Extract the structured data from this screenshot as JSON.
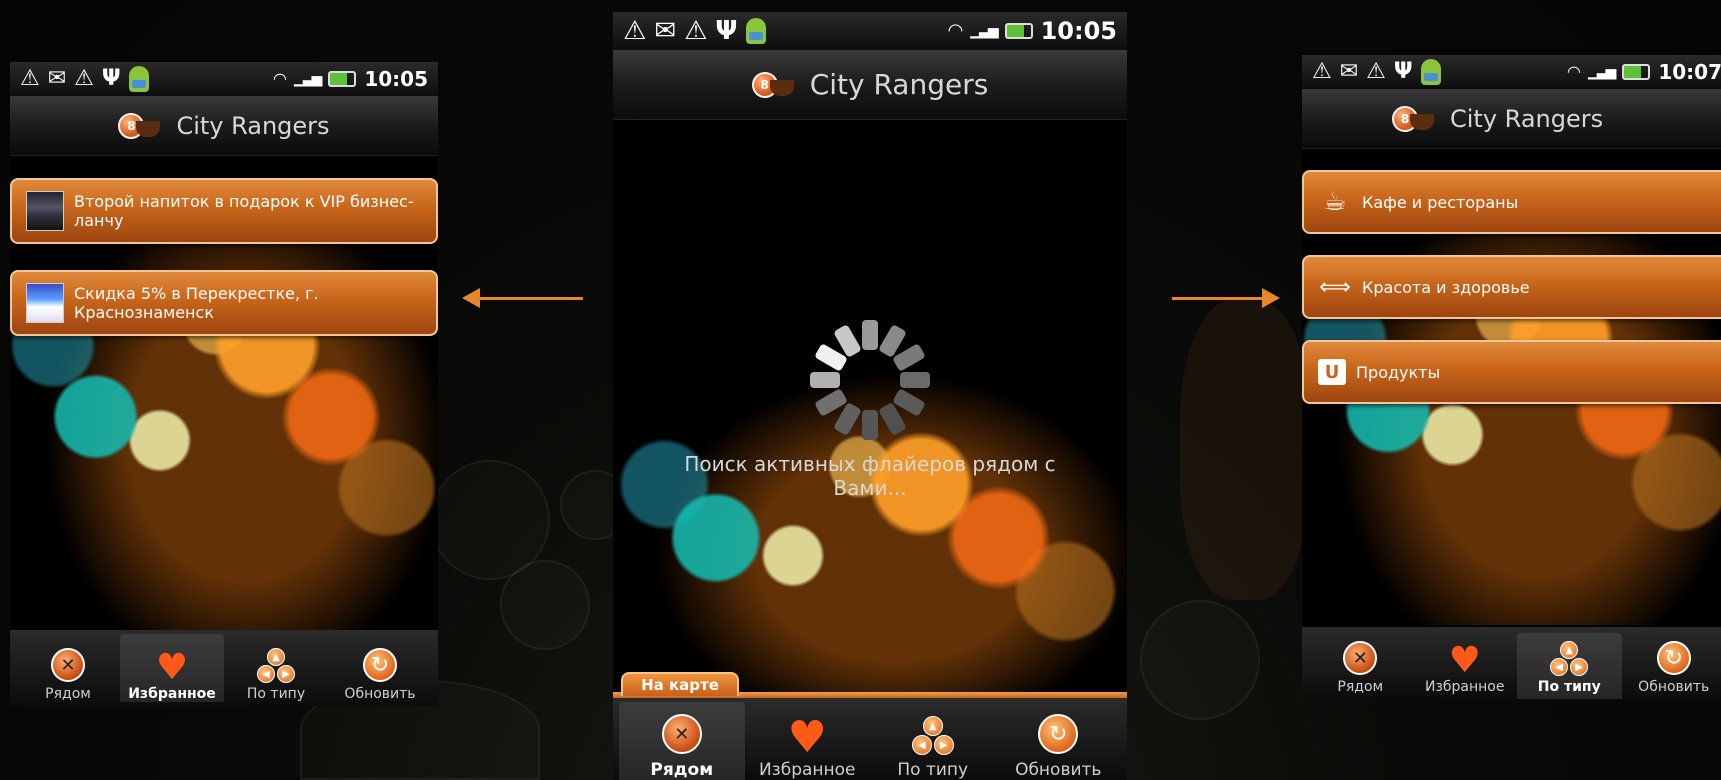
{
  "phones": {
    "left": {
      "status": {
        "time": "10:05"
      },
      "title": "City Rangers",
      "badge": "8",
      "items": [
        {
          "label": "Второй напиток в подарок к VIP бизнес-ланчу",
          "icon": "flyer-thumbnail"
        },
        {
          "label": "Скидка 5% в Перекрестке, г. Краснознаменск",
          "icon": "flyer-thumbnail"
        }
      ],
      "nav": [
        {
          "label": "Рядом",
          "icon": "compass-icon"
        },
        {
          "label": "Избранное",
          "icon": "heart-icon",
          "active": true
        },
        {
          "label": "По типу",
          "icon": "categories-icon"
        },
        {
          "label": "Обновить",
          "icon": "refresh-icon"
        }
      ]
    },
    "center": {
      "status": {
        "time": "10:05"
      },
      "title": "City Rangers",
      "badge": "8",
      "loading_text": "Поиск активных флайеров рядом с Вами...",
      "map_tab": "На карте",
      "nav": [
        {
          "label": "Рядом",
          "icon": "compass-icon",
          "active": true
        },
        {
          "label": "Избранное",
          "icon": "heart-icon"
        },
        {
          "label": "По типу",
          "icon": "categories-icon"
        },
        {
          "label": "Обновить",
          "icon": "refresh-icon"
        }
      ]
    },
    "right": {
      "status": {
        "time": "10:07"
      },
      "title": "City Rangers",
      "badge": "8",
      "categories": [
        {
          "label": "Кафе и рестораны",
          "icon": "coffee-cup-icon"
        },
        {
          "label": "Красота и здоровье",
          "icon": "dumbbell-icon"
        },
        {
          "label": "Продукты",
          "icon": "shopping-bag-icon"
        }
      ],
      "nav": [
        {
          "label": "Рядом",
          "icon": "compass-icon"
        },
        {
          "label": "Избранное",
          "icon": "heart-icon"
        },
        {
          "label": "По типу",
          "icon": "categories-icon",
          "active": true
        },
        {
          "label": "Обновить",
          "icon": "refresh-icon"
        }
      ]
    }
  },
  "colors": {
    "accent_orange": "#e8862a",
    "button_orange": "#c8651a",
    "heart_red": "#ff5a1a"
  }
}
